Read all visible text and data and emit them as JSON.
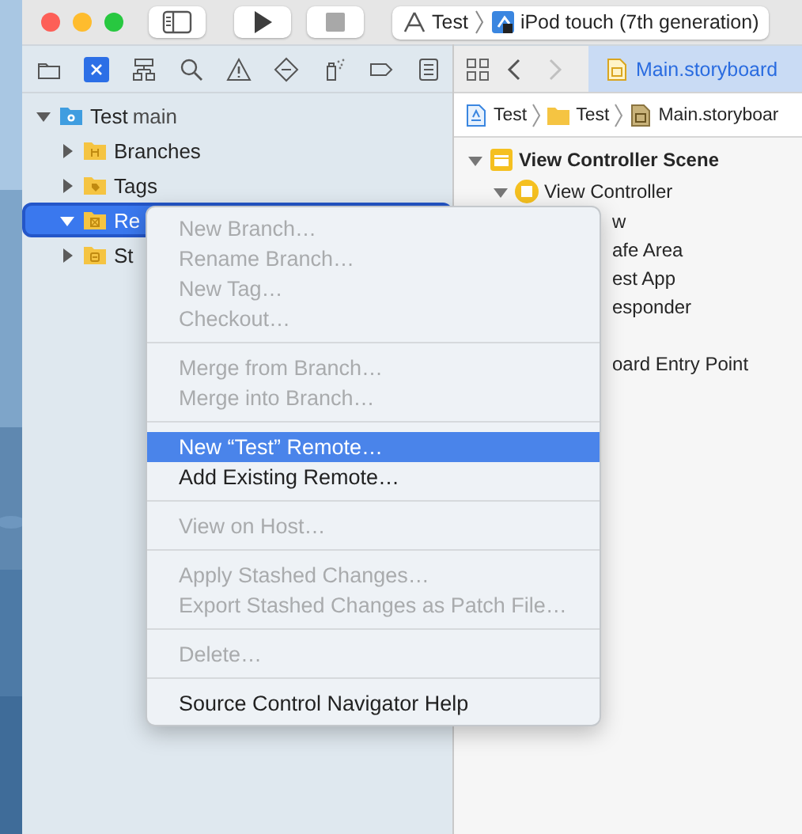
{
  "toolbar": {
    "scheme": {
      "project": "Test",
      "device": "iPod touch (7th generation)"
    }
  },
  "navigator": {
    "tabs": [
      {
        "selected": false
      },
      {
        "selected": true
      },
      {
        "selected": false
      },
      {
        "selected": false
      },
      {
        "selected": false
      },
      {
        "selected": false
      },
      {
        "selected": false
      },
      {
        "selected": false
      },
      {
        "selected": false
      }
    ],
    "tree": [
      {
        "label": "Test",
        "suffix": "main",
        "kind": "repo",
        "expanded": true,
        "selected": false,
        "children": [
          {
            "label": "Branches",
            "kind": "branches",
            "expanded": false,
            "selected": false
          },
          {
            "label": "Tags",
            "kind": "tags",
            "expanded": false,
            "selected": false
          },
          {
            "label": "Re",
            "kind": "remotes",
            "expanded": true,
            "selected": true
          },
          {
            "label": "St",
            "kind": "stashes",
            "expanded": false,
            "selected": false
          }
        ]
      }
    ]
  },
  "editor": {
    "nav_buttons": [
      {
        "kind": "back",
        "disabled": false
      },
      {
        "kind": "forward",
        "disabled": true
      }
    ],
    "tab": {
      "label": "Main.storyboard"
    },
    "jump_bar": [
      {
        "label": "Test",
        "kind": "project"
      },
      {
        "label": "Test",
        "kind": "folder"
      },
      {
        "label": "Main.storyboar",
        "kind": "storyboard"
      }
    ],
    "outline": [
      {
        "label": "View Controller Scene",
        "kind": "scene",
        "expanded": true
      },
      {
        "label": "View Controller",
        "kind": "controller",
        "expanded": true
      }
    ],
    "outline_clipped": [
      "w",
      "afe Area",
      "est App",
      "esponder",
      "oard Entry Point"
    ]
  },
  "context_menu": [
    {
      "kind": "item",
      "label": "New Branch…",
      "disabled": true,
      "selected": false
    },
    {
      "kind": "item",
      "label": "Rename Branch…",
      "disabled": true,
      "selected": false
    },
    {
      "kind": "item",
      "label": "New Tag…",
      "disabled": true,
      "selected": false
    },
    {
      "kind": "item",
      "label": "Checkout…",
      "disabled": true,
      "selected": false
    },
    {
      "kind": "separator"
    },
    {
      "kind": "item",
      "label": "Merge from Branch…",
      "disabled": true,
      "selected": false
    },
    {
      "kind": "item",
      "label": "Merge into Branch…",
      "disabled": true,
      "selected": false
    },
    {
      "kind": "separator"
    },
    {
      "kind": "item",
      "label": "New “Test” Remote…",
      "disabled": false,
      "selected": true
    },
    {
      "kind": "item",
      "label": "Add Existing Remote…",
      "disabled": false,
      "selected": false
    },
    {
      "kind": "separator"
    },
    {
      "kind": "item",
      "label": "View on Host…",
      "disabled": true,
      "selected": false
    },
    {
      "kind": "separator"
    },
    {
      "kind": "item",
      "label": "Apply Stashed Changes…",
      "disabled": true,
      "selected": false
    },
    {
      "kind": "item",
      "label": "Export Stashed Changes as Patch File…",
      "disabled": true,
      "selected": false
    },
    {
      "kind": "separator"
    },
    {
      "kind": "item",
      "label": "Delete…",
      "disabled": true,
      "selected": false
    },
    {
      "kind": "separator"
    },
    {
      "kind": "item",
      "label": "Source Control Navigator Help",
      "disabled": false,
      "selected": false
    }
  ]
}
